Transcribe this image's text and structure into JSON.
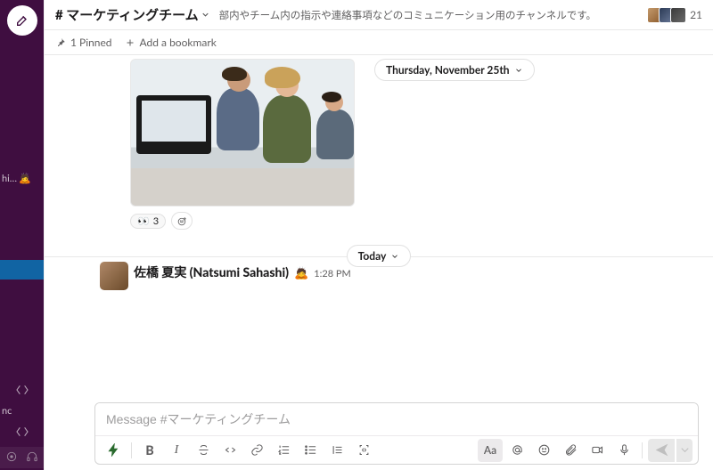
{
  "rail": {
    "channel_fragment": "hi…",
    "channel_emoji": "🙇",
    "nc_label": "nc"
  },
  "channel": {
    "name_prefix": "# ",
    "name": "マーケティングチーム",
    "topic": "部内やチーム内の指示や連絡事項などのコミュニケーション用のチャンネルです。",
    "member_count": "21"
  },
  "subheader": {
    "pinned_label": "1 Pinned",
    "add_bookmark_label": "Add a bookmark"
  },
  "dates": {
    "thursday": "Thursday, November 25th",
    "today": "Today"
  },
  "reactions": {
    "eyes_emoji": "👀",
    "eyes_count": "3"
  },
  "message": {
    "author": "佐橋 夏実 (Natsumi Sahashi)",
    "status_emoji": "🙇",
    "time": "1:28 PM"
  },
  "composer": {
    "placeholder": "Message #マーケティングチーム",
    "aa": "Aa"
  },
  "toolbar": {
    "bold": "B",
    "italic": "I"
  }
}
